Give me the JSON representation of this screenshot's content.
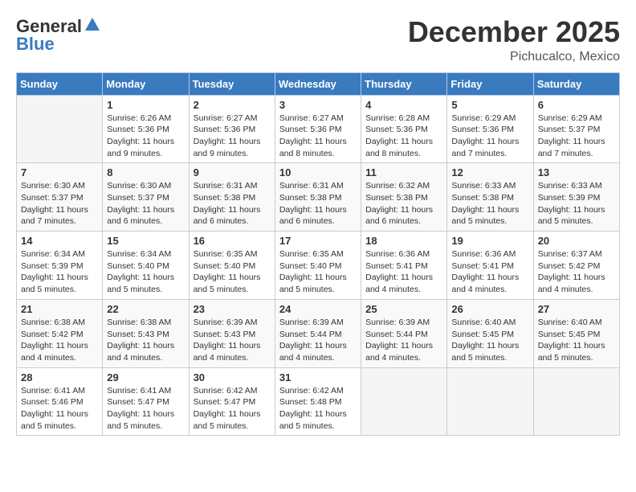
{
  "header": {
    "logo_general": "General",
    "logo_blue": "Blue",
    "month": "December 2025",
    "location": "Pichucalco, Mexico"
  },
  "days_of_week": [
    "Sunday",
    "Monday",
    "Tuesday",
    "Wednesday",
    "Thursday",
    "Friday",
    "Saturday"
  ],
  "weeks": [
    [
      {
        "day": "",
        "empty": true
      },
      {
        "day": "1",
        "sunrise": "6:26 AM",
        "sunset": "5:36 PM",
        "daylight": "11 hours and 9 minutes."
      },
      {
        "day": "2",
        "sunrise": "6:27 AM",
        "sunset": "5:36 PM",
        "daylight": "11 hours and 9 minutes."
      },
      {
        "day": "3",
        "sunrise": "6:27 AM",
        "sunset": "5:36 PM",
        "daylight": "11 hours and 8 minutes."
      },
      {
        "day": "4",
        "sunrise": "6:28 AM",
        "sunset": "5:36 PM",
        "daylight": "11 hours and 8 minutes."
      },
      {
        "day": "5",
        "sunrise": "6:29 AM",
        "sunset": "5:36 PM",
        "daylight": "11 hours and 7 minutes."
      },
      {
        "day": "6",
        "sunrise": "6:29 AM",
        "sunset": "5:37 PM",
        "daylight": "11 hours and 7 minutes."
      }
    ],
    [
      {
        "day": "7",
        "sunrise": "6:30 AM",
        "sunset": "5:37 PM",
        "daylight": "11 hours and 7 minutes."
      },
      {
        "day": "8",
        "sunrise": "6:30 AM",
        "sunset": "5:37 PM",
        "daylight": "11 hours and 6 minutes."
      },
      {
        "day": "9",
        "sunrise": "6:31 AM",
        "sunset": "5:38 PM",
        "daylight": "11 hours and 6 minutes."
      },
      {
        "day": "10",
        "sunrise": "6:31 AM",
        "sunset": "5:38 PM",
        "daylight": "11 hours and 6 minutes."
      },
      {
        "day": "11",
        "sunrise": "6:32 AM",
        "sunset": "5:38 PM",
        "daylight": "11 hours and 6 minutes."
      },
      {
        "day": "12",
        "sunrise": "6:33 AM",
        "sunset": "5:38 PM",
        "daylight": "11 hours and 5 minutes."
      },
      {
        "day": "13",
        "sunrise": "6:33 AM",
        "sunset": "5:39 PM",
        "daylight": "11 hours and 5 minutes."
      }
    ],
    [
      {
        "day": "14",
        "sunrise": "6:34 AM",
        "sunset": "5:39 PM",
        "daylight": "11 hours and 5 minutes."
      },
      {
        "day": "15",
        "sunrise": "6:34 AM",
        "sunset": "5:40 PM",
        "daylight": "11 hours and 5 minutes."
      },
      {
        "day": "16",
        "sunrise": "6:35 AM",
        "sunset": "5:40 PM",
        "daylight": "11 hours and 5 minutes."
      },
      {
        "day": "17",
        "sunrise": "6:35 AM",
        "sunset": "5:40 PM",
        "daylight": "11 hours and 5 minutes."
      },
      {
        "day": "18",
        "sunrise": "6:36 AM",
        "sunset": "5:41 PM",
        "daylight": "11 hours and 4 minutes."
      },
      {
        "day": "19",
        "sunrise": "6:36 AM",
        "sunset": "5:41 PM",
        "daylight": "11 hours and 4 minutes."
      },
      {
        "day": "20",
        "sunrise": "6:37 AM",
        "sunset": "5:42 PM",
        "daylight": "11 hours and 4 minutes."
      }
    ],
    [
      {
        "day": "21",
        "sunrise": "6:38 AM",
        "sunset": "5:42 PM",
        "daylight": "11 hours and 4 minutes."
      },
      {
        "day": "22",
        "sunrise": "6:38 AM",
        "sunset": "5:43 PM",
        "daylight": "11 hours and 4 minutes."
      },
      {
        "day": "23",
        "sunrise": "6:39 AM",
        "sunset": "5:43 PM",
        "daylight": "11 hours and 4 minutes."
      },
      {
        "day": "24",
        "sunrise": "6:39 AM",
        "sunset": "5:44 PM",
        "daylight": "11 hours and 4 minutes."
      },
      {
        "day": "25",
        "sunrise": "6:39 AM",
        "sunset": "5:44 PM",
        "daylight": "11 hours and 4 minutes."
      },
      {
        "day": "26",
        "sunrise": "6:40 AM",
        "sunset": "5:45 PM",
        "daylight": "11 hours and 5 minutes."
      },
      {
        "day": "27",
        "sunrise": "6:40 AM",
        "sunset": "5:45 PM",
        "daylight": "11 hours and 5 minutes."
      }
    ],
    [
      {
        "day": "28",
        "sunrise": "6:41 AM",
        "sunset": "5:46 PM",
        "daylight": "11 hours and 5 minutes."
      },
      {
        "day": "29",
        "sunrise": "6:41 AM",
        "sunset": "5:47 PM",
        "daylight": "11 hours and 5 minutes."
      },
      {
        "day": "30",
        "sunrise": "6:42 AM",
        "sunset": "5:47 PM",
        "daylight": "11 hours and 5 minutes."
      },
      {
        "day": "31",
        "sunrise": "6:42 AM",
        "sunset": "5:48 PM",
        "daylight": "11 hours and 5 minutes."
      },
      {
        "day": "",
        "empty": true
      },
      {
        "day": "",
        "empty": true
      },
      {
        "day": "",
        "empty": true
      }
    ]
  ],
  "labels": {
    "sunrise": "Sunrise:",
    "sunset": "Sunset:",
    "daylight": "Daylight:"
  }
}
